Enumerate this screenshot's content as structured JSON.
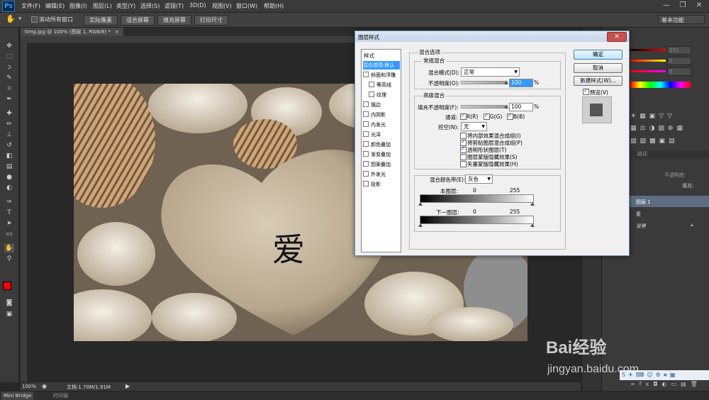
{
  "app": {
    "logo": "Ps"
  },
  "menu": [
    "文件(F)",
    "编辑(E)",
    "图像(I)",
    "图层(L)",
    "类型(Y)",
    "选择(S)",
    "滤镜(T)",
    "3D(D)",
    "视图(V)",
    "窗口(W)",
    "帮助(H)"
  ],
  "window_controls": {
    "minimize": "—",
    "restore": "❐",
    "close": "✕"
  },
  "options": {
    "scroll_all_label": "滚动所有窗口",
    "actual_pixels": "实际像素",
    "fit_screen": "适合屏幕",
    "fill_screen": "填充屏幕",
    "print_size": "打印尺寸",
    "workspace": "基本功能"
  },
  "document": {
    "tab_label": "timg.jpg @ 100% (图层 1, RGB/8) *",
    "tab_close": "×",
    "canvas_text": "爱"
  },
  "status": {
    "zoom": "100%",
    "doc_info": "文档:1.70M/1.91M"
  },
  "bottom_tabs": [
    "Mini Bridge",
    "时间轴"
  ],
  "panel": {
    "color_values": [
      "251",
      "0",
      "0"
    ],
    "layers_tab": "路径",
    "opacity_label": "不透明度:",
    "fill_label": "填充:",
    "layers": [
      {
        "name": "图层 1",
        "active": true
      },
      {
        "name": "爱",
        "active": false
      },
      {
        "name": "背景",
        "active": false
      }
    ]
  },
  "dialog": {
    "title": "图层样式",
    "close": "✕",
    "styles_header": "样式",
    "style_items": [
      {
        "label": "混合选项:默认",
        "checkbox": false,
        "active": true,
        "indent": false
      },
      {
        "label": "斜面和浮雕",
        "checkbox": true,
        "active": false,
        "indent": false
      },
      {
        "label": "等高线",
        "checkbox": true,
        "active": false,
        "indent": true
      },
      {
        "label": "纹理",
        "checkbox": true,
        "active": false,
        "indent": true
      },
      {
        "label": "描边",
        "checkbox": true,
        "active": false,
        "indent": false
      },
      {
        "label": "内阴影",
        "checkbox": true,
        "active": false,
        "indent": false
      },
      {
        "label": "内发光",
        "checkbox": true,
        "active": false,
        "indent": false
      },
      {
        "label": "光泽",
        "checkbox": true,
        "active": false,
        "indent": false
      },
      {
        "label": "颜色叠加",
        "checkbox": true,
        "active": false,
        "indent": false
      },
      {
        "label": "渐变叠加",
        "checkbox": true,
        "active": false,
        "indent": false
      },
      {
        "label": "图案叠加",
        "checkbox": true,
        "active": false,
        "indent": false
      },
      {
        "label": "外发光",
        "checkbox": true,
        "active": false,
        "indent": false
      },
      {
        "label": "投影",
        "checkbox": true,
        "active": false,
        "indent": false
      }
    ],
    "blend_options_title": "混合选项",
    "general_blend_title": "常规混合",
    "blend_mode_label": "混合模式(D):",
    "blend_mode_value": "正常",
    "opacity_label": "不透明度(O):",
    "opacity_value": "100",
    "percent": "%",
    "advanced_title": "高级混合",
    "fill_opacity_label": "填充不透明度(F):",
    "fill_opacity_value": "100",
    "channels_label": "通道:",
    "channels": [
      "R(R)",
      "G(G)",
      "B(B)"
    ],
    "knockout_label": "挖空(N):",
    "knockout_value": "无",
    "adv_checks": [
      {
        "label": "将内部效果混合成组(I)",
        "checked": false
      },
      {
        "label": "将剪贴图层混合成组(P)",
        "checked": true
      },
      {
        "label": "透明形状图层(T)",
        "checked": true
      },
      {
        "label": "图层蒙版隐藏效果(S)",
        "checked": false
      },
      {
        "label": "矢量蒙版隐藏效果(H)",
        "checked": false
      }
    ],
    "blend_if_label": "混合颜色带(E):",
    "blend_if_value": "灰色",
    "this_layer_label": "本图层:",
    "underlying_label": "下一图层:",
    "range_min": "0",
    "range_max": "255",
    "ok": "确定",
    "cancel": "取消",
    "new_style": "新建样式(W)...",
    "preview_label": "预览(V)"
  },
  "watermark": {
    "brand": "Bai经验",
    "url": "jingyan.baidu.com"
  }
}
